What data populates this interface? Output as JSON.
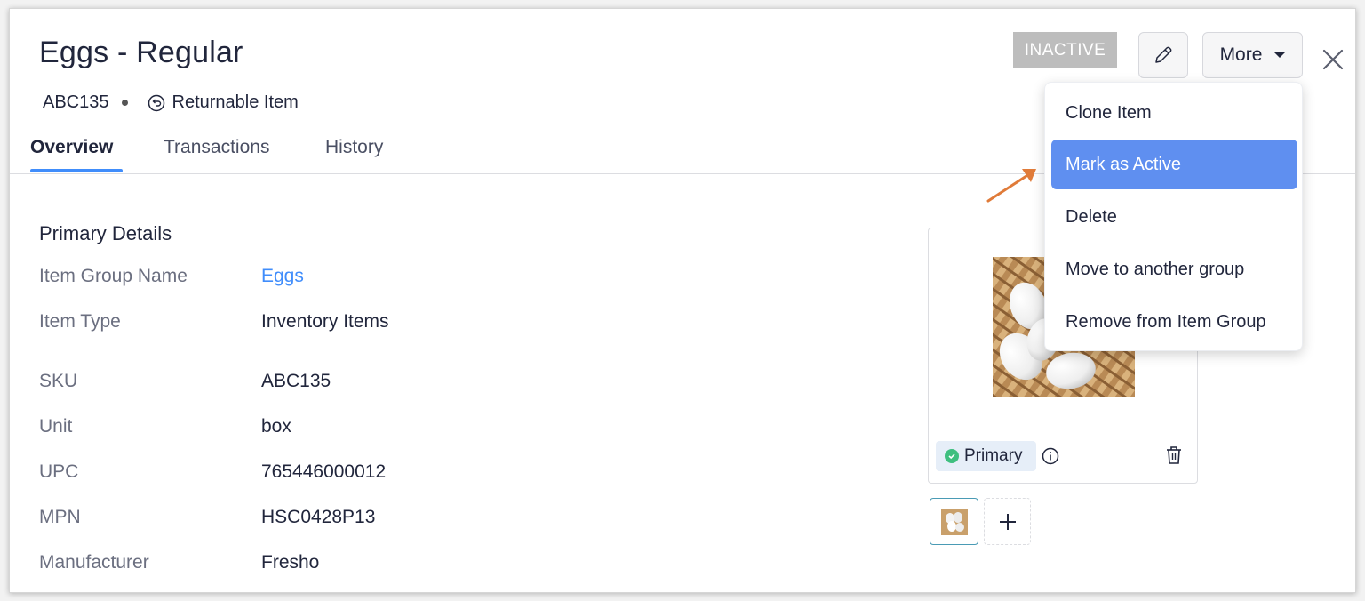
{
  "header": {
    "title": "Eggs - Regular",
    "sku": "ABC135",
    "returnable_label": "Returnable Item",
    "status": "INACTIVE",
    "more_label": "More"
  },
  "tabs": [
    {
      "label": "Overview",
      "active": true
    },
    {
      "label": "Transactions",
      "active": false
    },
    {
      "label": "History",
      "active": false
    }
  ],
  "details": {
    "section_title": "Primary Details",
    "rows": [
      {
        "label": "Item Group Name",
        "value": "Eggs",
        "link": true
      },
      {
        "label": "Item Type",
        "value": "Inventory Items"
      },
      {
        "label": "SKU",
        "value": "ABC135"
      },
      {
        "label": "Unit",
        "value": "box"
      },
      {
        "label": "UPC",
        "value": "765446000012"
      },
      {
        "label": "MPN",
        "value": "HSC0428P13"
      },
      {
        "label": "Manufacturer",
        "value": "Fresho"
      }
    ]
  },
  "image_panel": {
    "primary_label": "Primary"
  },
  "more_menu": {
    "items": [
      {
        "label": "Clone Item"
      },
      {
        "label": "Mark as Active",
        "highlighted": true
      },
      {
        "label": "Delete"
      },
      {
        "label": "Move to another group"
      },
      {
        "label": "Remove from Item Group"
      }
    ]
  },
  "colors": {
    "accent": "#408dfb",
    "menu_highlight": "#5f8ff0",
    "status_badge": "#bdbdbd",
    "annotation_arrow": "#e07b39"
  },
  "icons": [
    "returnable-icon",
    "pencil-icon",
    "caret-down-icon",
    "close-icon",
    "check-icon",
    "info-icon",
    "trash-icon",
    "plus-icon"
  ]
}
